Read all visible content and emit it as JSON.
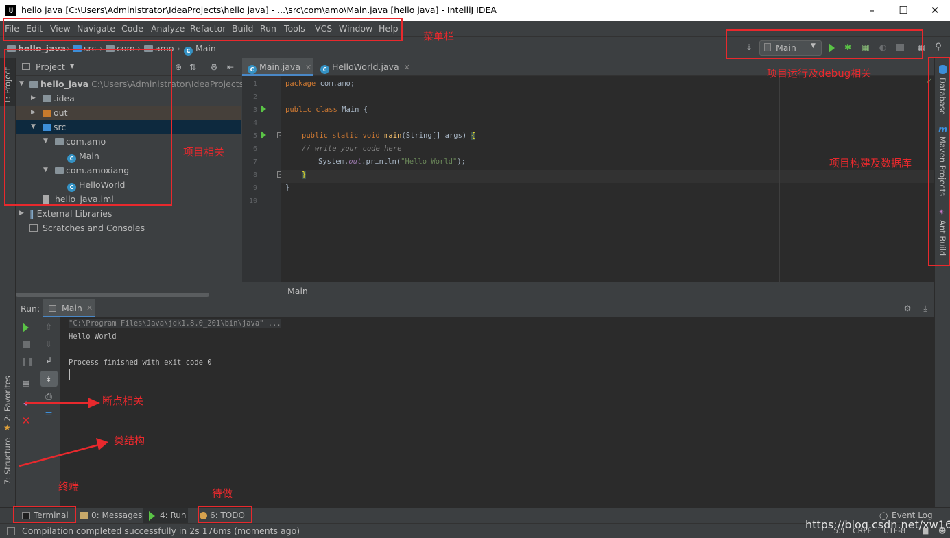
{
  "window": {
    "title": "hello java [C:\\Users\\Administrator\\IdeaProjects\\hello java] - ...\\src\\com\\amo\\Main.java [hello java] - IntelliJ IDEA",
    "app_icon": "IJ"
  },
  "menu": [
    "File",
    "Edit",
    "View",
    "Navigate",
    "Code",
    "Analyze",
    "Refactor",
    "Build",
    "Run",
    "Tools",
    "VCS",
    "Window",
    "Help"
  ],
  "breadcrumb": [
    "hello_java",
    "src",
    "com",
    "amo",
    "Main"
  ],
  "run_config": {
    "selected": "Main"
  },
  "left_tool_windows": [
    "1: Project",
    "2: Favorites",
    "7: Structure"
  ],
  "right_tool_windows": [
    "Database",
    "Maven Projects",
    "Ant Build"
  ],
  "project": {
    "header": "Project",
    "root_name": "hello_java",
    "root_path": "C:\\Users\\Administrator\\IdeaProjects\\h",
    "tree": [
      ".idea",
      "out",
      "src",
      "com.amo",
      "Main",
      "com.amoxiang",
      "HelloWorld",
      "hello_java.iml",
      "External Libraries",
      "Scratches and Consoles"
    ]
  },
  "editor": {
    "tabs": [
      "Main.java",
      "HelloWorld.java"
    ],
    "line_numbers": [
      "1",
      "2",
      "3",
      "4",
      "5",
      "6",
      "7",
      "8",
      "9",
      "10"
    ],
    "code": {
      "l1_kw": "package ",
      "l1_rest": "com.amo;",
      "l3_kw": "public class ",
      "l3_rest": "Main {",
      "l5_kw": "public static void ",
      "l5_fn": "main",
      "l5_rest": "(String[] args) ",
      "l5_brace": "{",
      "l6_cm": "// write your code here",
      "l7_a": "System.",
      "l7_it": "out",
      "l7_b": ".println(",
      "l7_str": "\"Hello World\"",
      "l7_c": ");",
      "l8": "}",
      "l9": "}"
    },
    "footer": "Main"
  },
  "run": {
    "label": "Run:",
    "tab": "Main",
    "console": {
      "cmd": "\"C:\\Program Files\\Java\\jdk1.8.0_201\\bin\\java\" ...",
      "out1": "Hello World",
      "out2": "Process finished with exit code 0"
    }
  },
  "bottom_tabs": [
    "Terminal",
    "0: Messages",
    "4: Run",
    "6: TODO"
  ],
  "event_log": "Event Log",
  "status": {
    "message": "Compilation completed successfully in 2s 176ms (moments ago)",
    "position": "5:1",
    "line_sep": "CRLF",
    "encoding": "UTF-8",
    "watermark": "https://blog.csdn.net/xw1680"
  },
  "annotations": {
    "menu": "菜单栏",
    "project": "项目相关",
    "run_debug": "项目运行及debug相关",
    "build_db": "项目构建及数据库",
    "breakpoints": "断点相关",
    "structure": "类结构",
    "terminal": "终端",
    "todo": "待做"
  },
  "colors": {
    "background": "#3c3f41",
    "editor_bg": "#2b2b2b",
    "annotation_red": "#e8292d",
    "run_green": "#5ac346",
    "selection": "#0d293e",
    "keyword": "#cc7832",
    "string": "#6a8759"
  }
}
